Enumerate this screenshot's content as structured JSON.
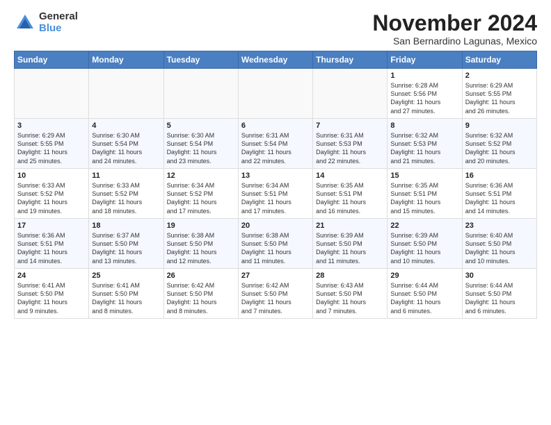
{
  "logo": {
    "general": "General",
    "blue": "Blue"
  },
  "title": "November 2024",
  "subtitle": "San Bernardino Lagunas, Mexico",
  "headers": [
    "Sunday",
    "Monday",
    "Tuesday",
    "Wednesday",
    "Thursday",
    "Friday",
    "Saturday"
  ],
  "weeks": [
    [
      {
        "day": "",
        "info": ""
      },
      {
        "day": "",
        "info": ""
      },
      {
        "day": "",
        "info": ""
      },
      {
        "day": "",
        "info": ""
      },
      {
        "day": "",
        "info": ""
      },
      {
        "day": "1",
        "info": "Sunrise: 6:28 AM\nSunset: 5:56 PM\nDaylight: 11 hours\nand 27 minutes."
      },
      {
        "day": "2",
        "info": "Sunrise: 6:29 AM\nSunset: 5:55 PM\nDaylight: 11 hours\nand 26 minutes."
      }
    ],
    [
      {
        "day": "3",
        "info": "Sunrise: 6:29 AM\nSunset: 5:55 PM\nDaylight: 11 hours\nand 25 minutes."
      },
      {
        "day": "4",
        "info": "Sunrise: 6:30 AM\nSunset: 5:54 PM\nDaylight: 11 hours\nand 24 minutes."
      },
      {
        "day": "5",
        "info": "Sunrise: 6:30 AM\nSunset: 5:54 PM\nDaylight: 11 hours\nand 23 minutes."
      },
      {
        "day": "6",
        "info": "Sunrise: 6:31 AM\nSunset: 5:54 PM\nDaylight: 11 hours\nand 22 minutes."
      },
      {
        "day": "7",
        "info": "Sunrise: 6:31 AM\nSunset: 5:53 PM\nDaylight: 11 hours\nand 22 minutes."
      },
      {
        "day": "8",
        "info": "Sunrise: 6:32 AM\nSunset: 5:53 PM\nDaylight: 11 hours\nand 21 minutes."
      },
      {
        "day": "9",
        "info": "Sunrise: 6:32 AM\nSunset: 5:52 PM\nDaylight: 11 hours\nand 20 minutes."
      }
    ],
    [
      {
        "day": "10",
        "info": "Sunrise: 6:33 AM\nSunset: 5:52 PM\nDaylight: 11 hours\nand 19 minutes."
      },
      {
        "day": "11",
        "info": "Sunrise: 6:33 AM\nSunset: 5:52 PM\nDaylight: 11 hours\nand 18 minutes."
      },
      {
        "day": "12",
        "info": "Sunrise: 6:34 AM\nSunset: 5:52 PM\nDaylight: 11 hours\nand 17 minutes."
      },
      {
        "day": "13",
        "info": "Sunrise: 6:34 AM\nSunset: 5:51 PM\nDaylight: 11 hours\nand 17 minutes."
      },
      {
        "day": "14",
        "info": "Sunrise: 6:35 AM\nSunset: 5:51 PM\nDaylight: 11 hours\nand 16 minutes."
      },
      {
        "day": "15",
        "info": "Sunrise: 6:35 AM\nSunset: 5:51 PM\nDaylight: 11 hours\nand 15 minutes."
      },
      {
        "day": "16",
        "info": "Sunrise: 6:36 AM\nSunset: 5:51 PM\nDaylight: 11 hours\nand 14 minutes."
      }
    ],
    [
      {
        "day": "17",
        "info": "Sunrise: 6:36 AM\nSunset: 5:51 PM\nDaylight: 11 hours\nand 14 minutes."
      },
      {
        "day": "18",
        "info": "Sunrise: 6:37 AM\nSunset: 5:50 PM\nDaylight: 11 hours\nand 13 minutes."
      },
      {
        "day": "19",
        "info": "Sunrise: 6:38 AM\nSunset: 5:50 PM\nDaylight: 11 hours\nand 12 minutes."
      },
      {
        "day": "20",
        "info": "Sunrise: 6:38 AM\nSunset: 5:50 PM\nDaylight: 11 hours\nand 11 minutes."
      },
      {
        "day": "21",
        "info": "Sunrise: 6:39 AM\nSunset: 5:50 PM\nDaylight: 11 hours\nand 11 minutes."
      },
      {
        "day": "22",
        "info": "Sunrise: 6:39 AM\nSunset: 5:50 PM\nDaylight: 11 hours\nand 10 minutes."
      },
      {
        "day": "23",
        "info": "Sunrise: 6:40 AM\nSunset: 5:50 PM\nDaylight: 11 hours\nand 10 minutes."
      }
    ],
    [
      {
        "day": "24",
        "info": "Sunrise: 6:41 AM\nSunset: 5:50 PM\nDaylight: 11 hours\nand 9 minutes."
      },
      {
        "day": "25",
        "info": "Sunrise: 6:41 AM\nSunset: 5:50 PM\nDaylight: 11 hours\nand 8 minutes."
      },
      {
        "day": "26",
        "info": "Sunrise: 6:42 AM\nSunset: 5:50 PM\nDaylight: 11 hours\nand 8 minutes."
      },
      {
        "day": "27",
        "info": "Sunrise: 6:42 AM\nSunset: 5:50 PM\nDaylight: 11 hours\nand 7 minutes."
      },
      {
        "day": "28",
        "info": "Sunrise: 6:43 AM\nSunset: 5:50 PM\nDaylight: 11 hours\nand 7 minutes."
      },
      {
        "day": "29",
        "info": "Sunrise: 6:44 AM\nSunset: 5:50 PM\nDaylight: 11 hours\nand 6 minutes."
      },
      {
        "day": "30",
        "info": "Sunrise: 6:44 AM\nSunset: 5:50 PM\nDaylight: 11 hours\nand 6 minutes."
      }
    ]
  ]
}
